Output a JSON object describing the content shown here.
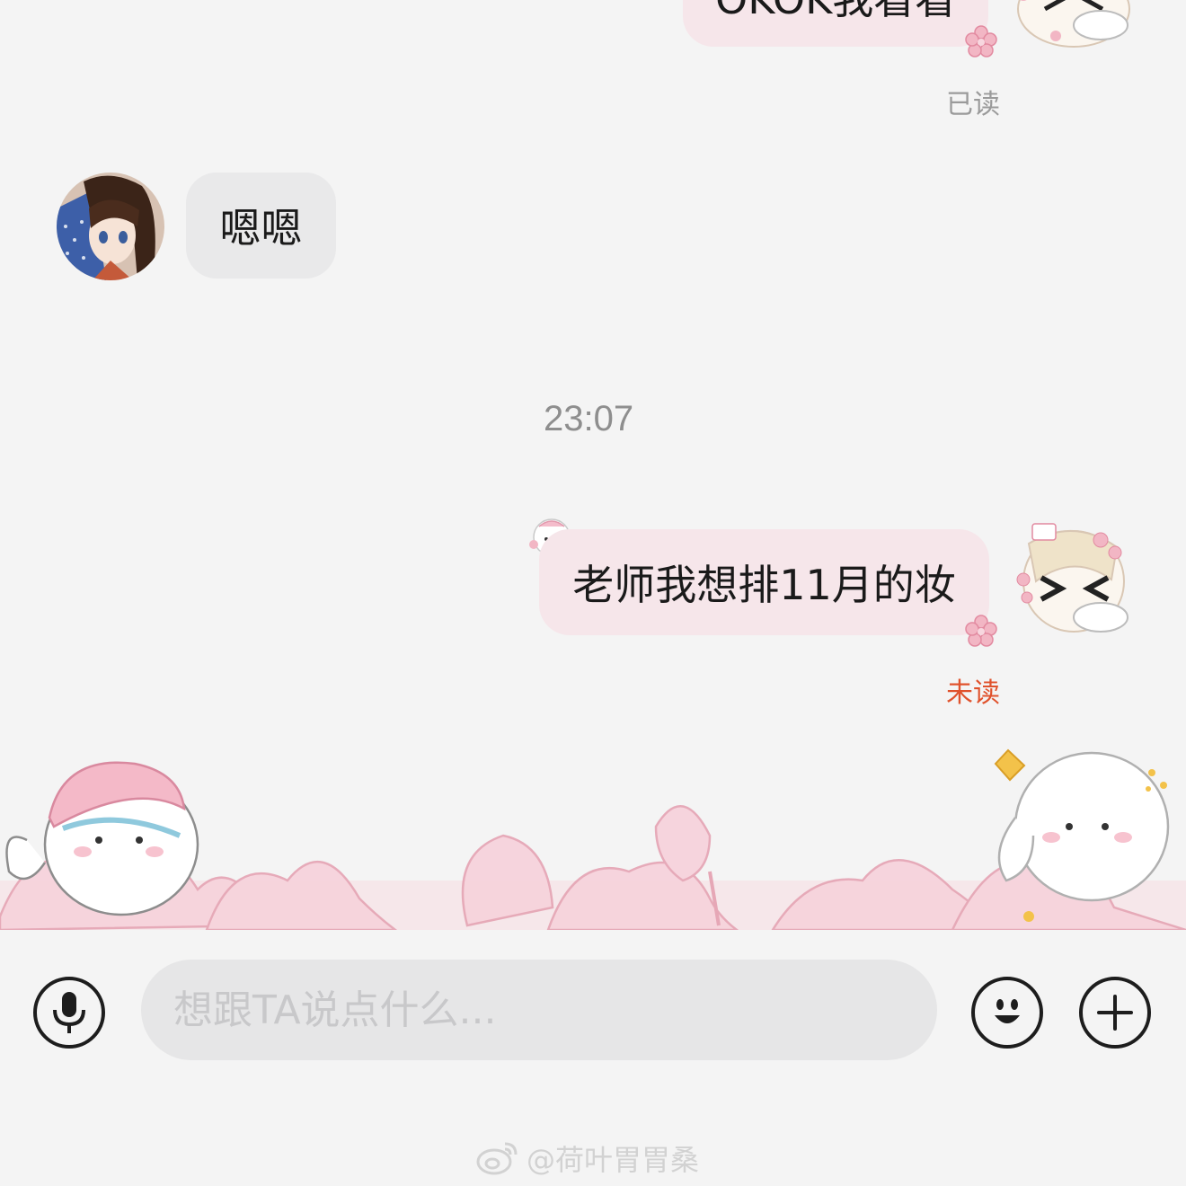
{
  "messages": {
    "partial_sent": {
      "text": "OKOK我看看",
      "status": "已读"
    },
    "received": {
      "text": "嗯嗯"
    },
    "timestamp": "23:07",
    "sent": {
      "text": "老师我想排11月的妆",
      "status": "未读"
    }
  },
  "colors": {
    "read_status": "#9a9a9a",
    "unread_status": "#e0522c",
    "my_bubble": "#f6e6ea",
    "other_bubble": "#e9e9ea"
  },
  "toolbar": {
    "voice_icon": "microphone-icon",
    "input_placeholder": "想跟TA说点什么...",
    "emoji_icon": "smile-icon",
    "more_icon": "plus-icon"
  },
  "watermark": {
    "icon": "weibo-icon",
    "text": "@荷叶胃胃桑"
  }
}
